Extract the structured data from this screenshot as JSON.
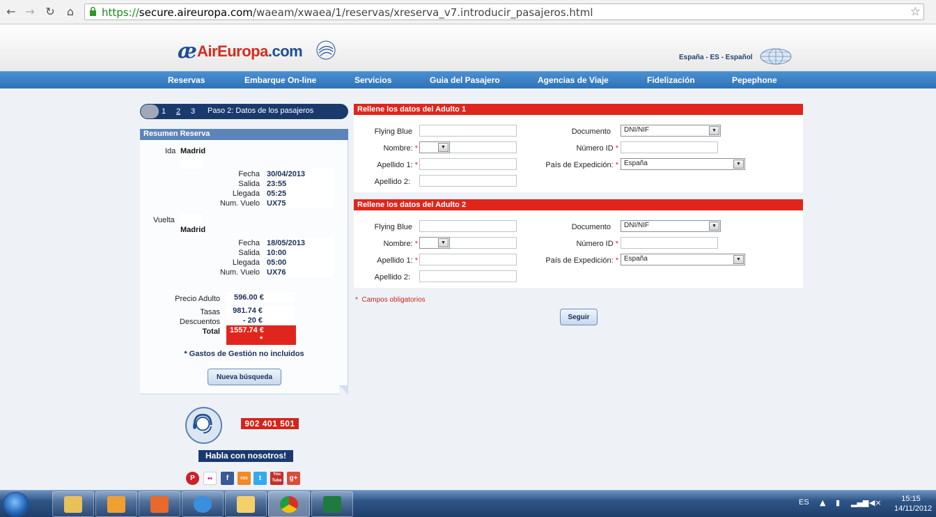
{
  "browser": {
    "url_scheme": "https://",
    "url_host": "secure.aireuropa.com",
    "url_path": "/waeam/xwaea/1/reservas/xreserva_v7.introducir_pasajeros.html"
  },
  "site": {
    "logo_text": "AirEuropa",
    "logo_suffix": ".com",
    "language": "España - ES - Español"
  },
  "nav": [
    "Reservas",
    "Embarque On-line",
    "Servicios",
    "Guia del Pasajero",
    "Agencias de Viaje",
    "Fidelización",
    "Pepephone"
  ],
  "steps": {
    "numbers": [
      "1",
      "2",
      "3"
    ],
    "current_label": "Paso 2: Datos de los pasajeros"
  },
  "summary": {
    "title": "Resumen Reserva",
    "ida": {
      "label": "Ida",
      "city": "Madrid",
      "fecha_label": "Fecha",
      "fecha": "30/04/2013",
      "salida_label": "Salida",
      "salida": "23:55",
      "llegada_label": "Llegada",
      "llegada": "05:25",
      "vuelo_label": "Num. Vuelo",
      "vuelo": "UX75"
    },
    "vuelta": {
      "label": "Vuelta",
      "city": "Madrid",
      "fecha_label": "Fecha",
      "fecha": "18/05/2013",
      "salida_label": "Salida",
      "salida": "10:00",
      "llegada_label": "Llegada",
      "llegada": "05:00",
      "vuelo_label": "Num. Vuelo",
      "vuelo": "UX76"
    },
    "precio_label": "Precio Adulto",
    "precio": "596.00 €",
    "tasas_label": "Tasas",
    "tasas": "981.74 €",
    "descuentos_label": "Descuentos",
    "descuentos": "- 20 €",
    "total_label": "Total",
    "total": "1557.74 €",
    "total_mark": "*",
    "gastos_note": "* Gastos de Gestión no incluidos",
    "new_search_button": "Nueva búsqueda"
  },
  "contact": {
    "phone": "902 401 501",
    "cta": "Habla con nosotros!",
    "social": [
      "P",
      "••",
      "f",
      "rss",
      "t",
      "You Tube",
      "g+"
    ]
  },
  "adults": [
    {
      "title": "Rellene los datos del Adulto 1",
      "flying_blue_label": "Flying Blue",
      "nombre_label": "Nombre:",
      "apellido1_label": "Apellido 1:",
      "apellido2_label": "Apellido 2:",
      "documento_label": "Documento",
      "documento_value": "DNI/NIF",
      "numero_label": "Número ID",
      "pais_label": "País de Expedición:",
      "pais_value": "España"
    },
    {
      "title": "Rellene los datos del Adulto 2",
      "flying_blue_label": "Flying Blue",
      "nombre_label": "Nombre:",
      "apellido1_label": "Apellido 1:",
      "apellido2_label": "Apellido 2:",
      "documento_label": "Documento",
      "documento_value": "DNI/NIF",
      "numero_label": "Número ID",
      "pais_label": "País de Expedición:",
      "pais_value": "España"
    }
  ],
  "required_marker": "*",
  "required_note": "Campos obligatorios",
  "continue_button": "Seguir",
  "taskbar": {
    "lang": "ES",
    "time": "15:15",
    "date": "14/11/2012"
  },
  "colors": {
    "brand_blue": "#1a3a6e",
    "nav_blue": "#2f73b8",
    "accent_red": "#e0261c"
  }
}
